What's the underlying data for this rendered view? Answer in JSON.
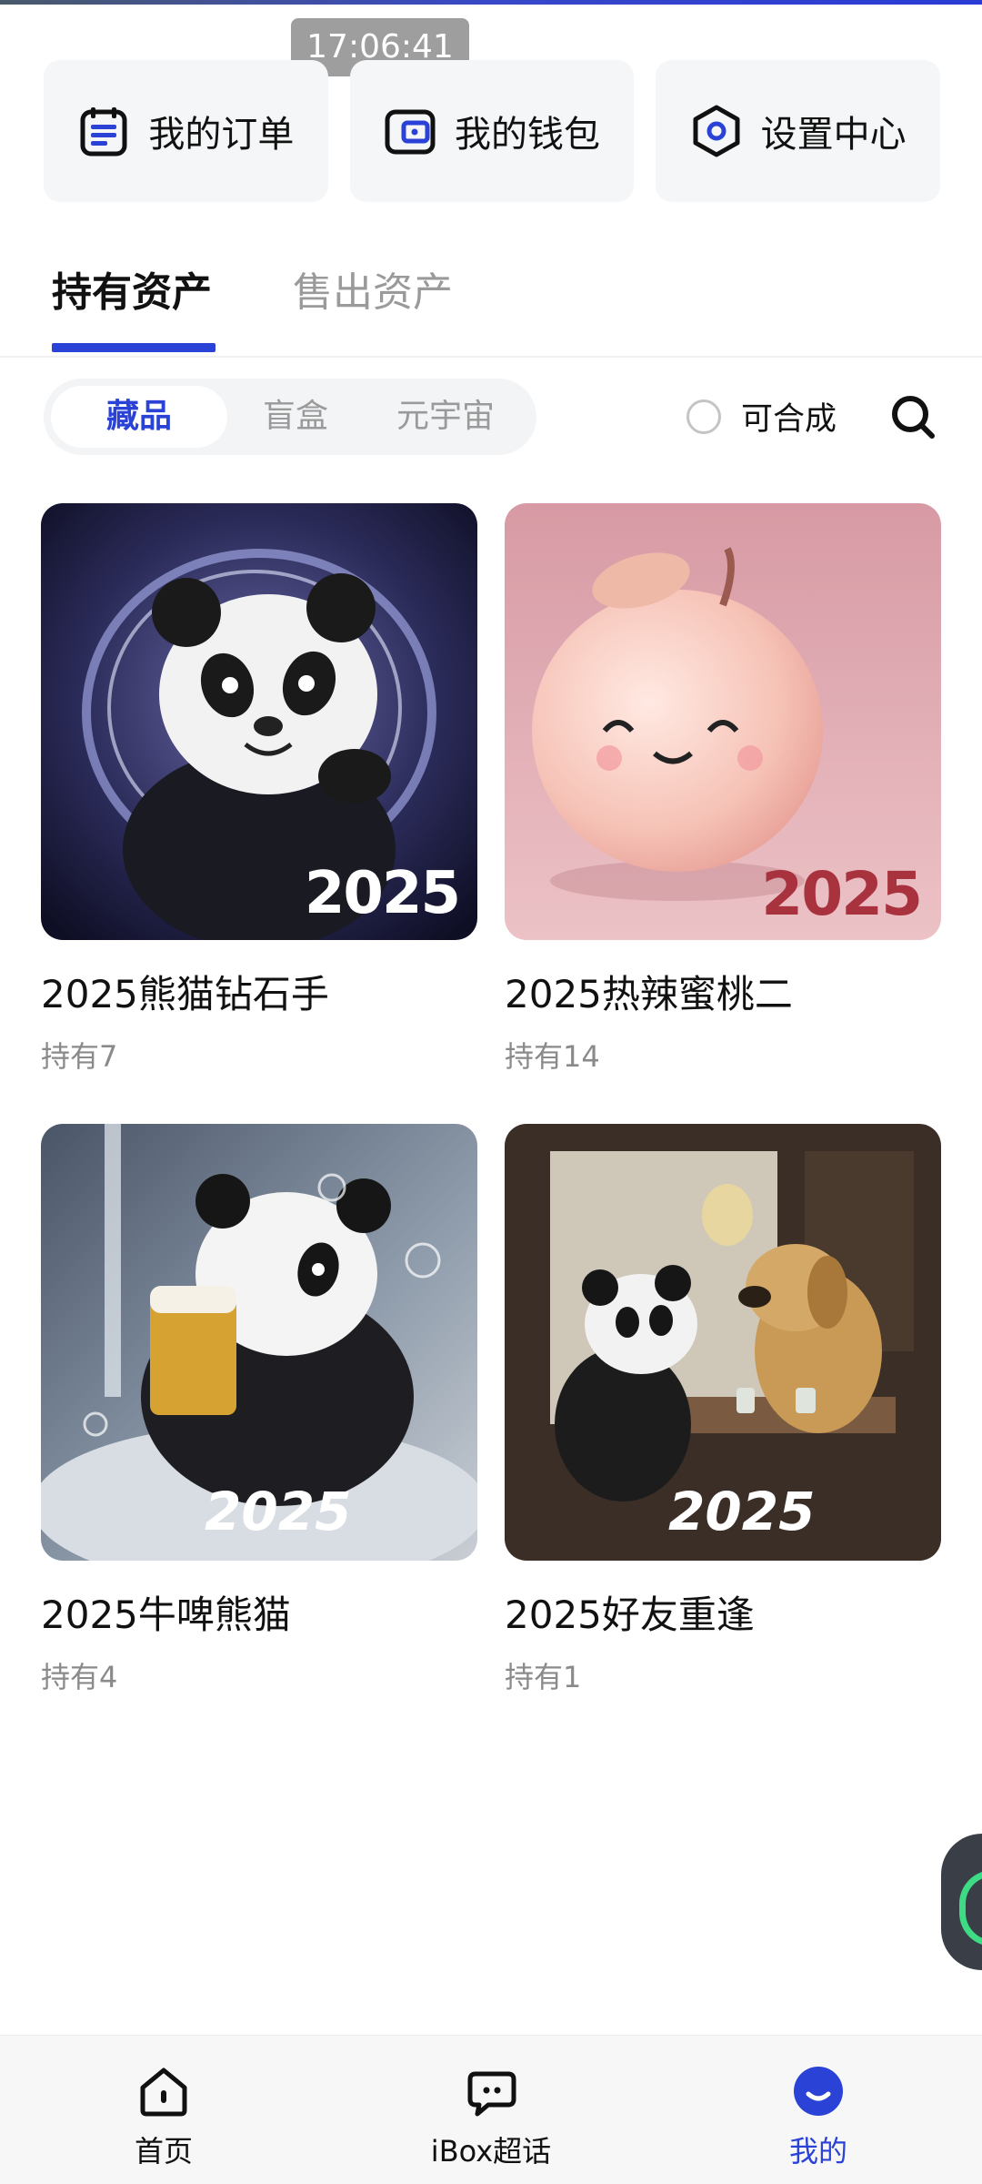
{
  "status_bar": {
    "time": "17:06:41"
  },
  "quick_actions": [
    {
      "label": "我的订单",
      "icon": "order-list-icon"
    },
    {
      "label": "我的钱包",
      "icon": "wallet-icon"
    },
    {
      "label": "设置中心",
      "icon": "settings-hex-icon"
    }
  ],
  "asset_tabs": [
    {
      "label": "持有资产",
      "active": true
    },
    {
      "label": "售出资产",
      "active": false
    }
  ],
  "segments": [
    {
      "label": "藏品",
      "active": true
    },
    {
      "label": "盲盒",
      "active": false
    },
    {
      "label": "元宇宙",
      "active": false
    }
  ],
  "filter": {
    "compose_label": "可合成",
    "checked": false
  },
  "items": [
    {
      "title": "2025熊猫钻石手",
      "holding": "持有7",
      "image": "panda-diamond-hand-image",
      "year_mark": "2025"
    },
    {
      "title": "2025热辣蜜桃二",
      "holding": "持有14",
      "image": "smiling-peach-image",
      "year_mark": "2025"
    },
    {
      "title": "2025牛啤熊猫",
      "holding": "持有4",
      "image": "panda-beer-image",
      "year_mark": "2025"
    },
    {
      "title": "2025好友重逢",
      "holding": "持有1",
      "image": "panda-dog-reunion-image",
      "year_mark": "2025"
    }
  ],
  "bottom_nav": [
    {
      "label": "首页",
      "icon": "home-icon",
      "active": false
    },
    {
      "label": "iBox超话",
      "icon": "chat-icon",
      "active": false
    },
    {
      "label": "我的",
      "icon": "profile-icon",
      "active": true
    }
  ],
  "colors": {
    "accent": "#2a43d6",
    "muted": "#9a9a9a",
    "card_bg": "#f5f6f7"
  }
}
